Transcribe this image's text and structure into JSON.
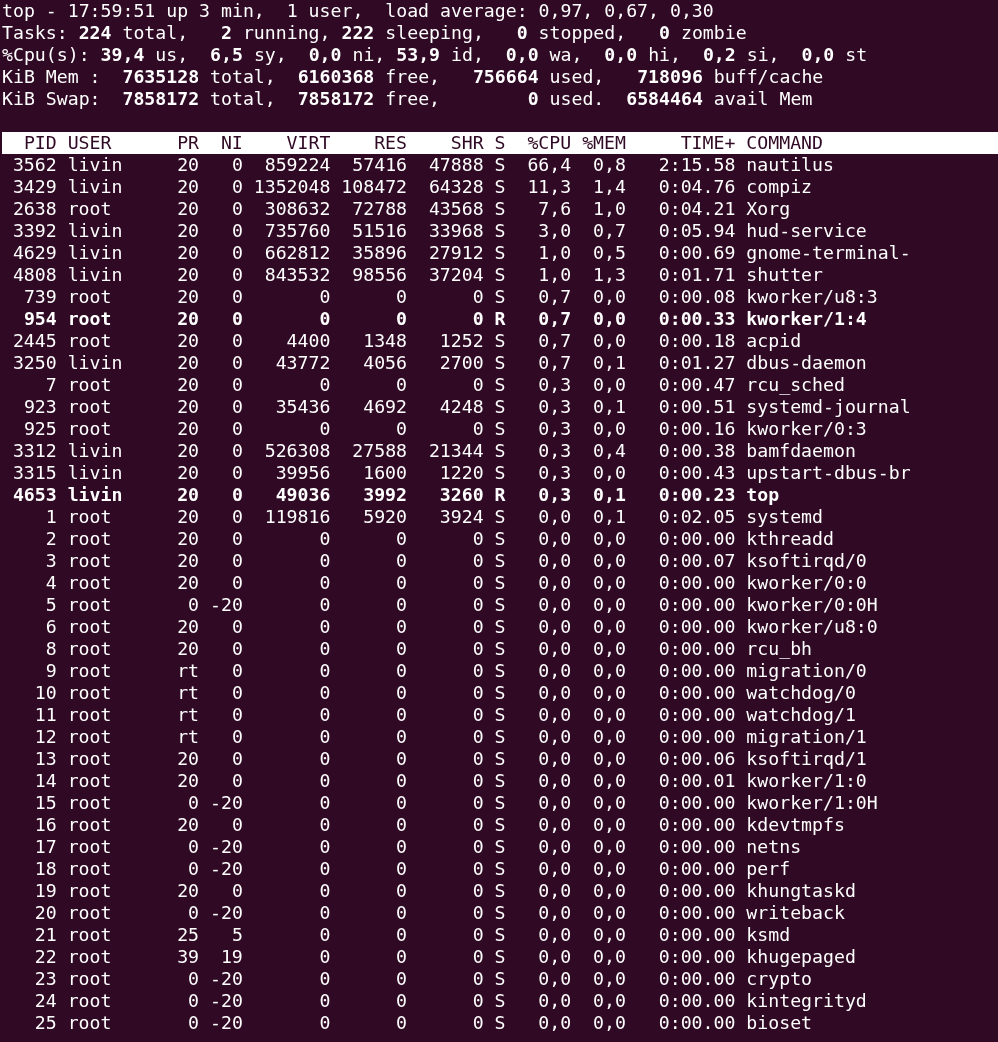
{
  "summary": [
    "top - 17:59:51 up 3 min,  1 user,  load average: 0,97, 0,67, 0,30",
    "Tasks: **224** total,   **2** running, **222** sleeping,   **0** stopped,   **0** zombie",
    "%Cpu(s): **39,4** us,  **6,5** sy,  **0,0** ni, **53,9** id,  **0,0** wa,  **0,0** hi,  **0,2** si,  **0,0** st",
    "KiB Mem :  **7635128** total,  **6160368** free,   **756664** used,   **718096** buff/cache",
    "KiB Swap:  **7858172** total,  **7858172** free,        **0** used.  **6584464** avail Mem"
  ],
  "table": {
    "columns": [
      "PID",
      "USER",
      "PR",
      "NI",
      "VIRT",
      "RES",
      "SHR",
      "S",
      "%CPU",
      "%MEM",
      "TIME+",
      "COMMAND"
    ],
    "rows": [
      {
        "highlighted": false,
        "cells": [
          "3562",
          "livin",
          "20",
          "0",
          "859224",
          "57416",
          "47888",
          "S",
          "66,4",
          "0,8",
          "2:15.58",
          "nautilus"
        ]
      },
      {
        "highlighted": false,
        "cells": [
          "3429",
          "livin",
          "20",
          "0",
          "1352048",
          "108472",
          "64328",
          "S",
          "11,3",
          "1,4",
          "0:04.76",
          "compiz"
        ]
      },
      {
        "highlighted": false,
        "cells": [
          "2638",
          "root",
          "20",
          "0",
          "308632",
          "72788",
          "43568",
          "S",
          "7,6",
          "1,0",
          "0:04.21",
          "Xorg"
        ]
      },
      {
        "highlighted": false,
        "cells": [
          "3392",
          "livin",
          "20",
          "0",
          "735760",
          "51516",
          "33968",
          "S",
          "3,0",
          "0,7",
          "0:05.94",
          "hud-service"
        ]
      },
      {
        "highlighted": false,
        "cells": [
          "4629",
          "livin",
          "20",
          "0",
          "662812",
          "35896",
          "27912",
          "S",
          "1,0",
          "0,5",
          "0:00.69",
          "gnome-terminal-"
        ]
      },
      {
        "highlighted": false,
        "cells": [
          "4808",
          "livin",
          "20",
          "0",
          "843532",
          "98556",
          "37204",
          "S",
          "1,0",
          "1,3",
          "0:01.71",
          "shutter"
        ]
      },
      {
        "highlighted": false,
        "cells": [
          "739",
          "root",
          "20",
          "0",
          "0",
          "0",
          "0",
          "S",
          "0,7",
          "0,0",
          "0:00.08",
          "kworker/u8:3"
        ]
      },
      {
        "highlighted": true,
        "cells": [
          "954",
          "root",
          "20",
          "0",
          "0",
          "0",
          "0",
          "R",
          "0,7",
          "0,0",
          "0:00.33",
          "kworker/1:4"
        ]
      },
      {
        "highlighted": false,
        "cells": [
          "2445",
          "root",
          "20",
          "0",
          "4400",
          "1348",
          "1252",
          "S",
          "0,7",
          "0,0",
          "0:00.18",
          "acpid"
        ]
      },
      {
        "highlighted": false,
        "cells": [
          "3250",
          "livin",
          "20",
          "0",
          "43772",
          "4056",
          "2700",
          "S",
          "0,7",
          "0,1",
          "0:01.27",
          "dbus-daemon"
        ]
      },
      {
        "highlighted": false,
        "cells": [
          "7",
          "root",
          "20",
          "0",
          "0",
          "0",
          "0",
          "S",
          "0,3",
          "0,0",
          "0:00.47",
          "rcu_sched"
        ]
      },
      {
        "highlighted": false,
        "cells": [
          "923",
          "root",
          "20",
          "0",
          "35436",
          "4692",
          "4248",
          "S",
          "0,3",
          "0,1",
          "0:00.51",
          "systemd-journal"
        ]
      },
      {
        "highlighted": false,
        "cells": [
          "925",
          "root",
          "20",
          "0",
          "0",
          "0",
          "0",
          "S",
          "0,3",
          "0,0",
          "0:00.16",
          "kworker/0:3"
        ]
      },
      {
        "highlighted": false,
        "cells": [
          "3312",
          "livin",
          "20",
          "0",
          "526308",
          "27588",
          "21344",
          "S",
          "0,3",
          "0,4",
          "0:00.38",
          "bamfdaemon"
        ]
      },
      {
        "highlighted": false,
        "cells": [
          "3315",
          "livin",
          "20",
          "0",
          "39956",
          "1600",
          "1220",
          "S",
          "0,3",
          "0,0",
          "0:00.43",
          "upstart-dbus-br"
        ]
      },
      {
        "highlighted": true,
        "cells": [
          "4653",
          "livin",
          "20",
          "0",
          "49036",
          "3992",
          "3260",
          "R",
          "0,3",
          "0,1",
          "0:00.23",
          "top"
        ]
      },
      {
        "highlighted": false,
        "cells": [
          "1",
          "root",
          "20",
          "0",
          "119816",
          "5920",
          "3924",
          "S",
          "0,0",
          "0,1",
          "0:02.05",
          "systemd"
        ]
      },
      {
        "highlighted": false,
        "cells": [
          "2",
          "root",
          "20",
          "0",
          "0",
          "0",
          "0",
          "S",
          "0,0",
          "0,0",
          "0:00.00",
          "kthreadd"
        ]
      },
      {
        "highlighted": false,
        "cells": [
          "3",
          "root",
          "20",
          "0",
          "0",
          "0",
          "0",
          "S",
          "0,0",
          "0,0",
          "0:00.07",
          "ksoftirqd/0"
        ]
      },
      {
        "highlighted": false,
        "cells": [
          "4",
          "root",
          "20",
          "0",
          "0",
          "0",
          "0",
          "S",
          "0,0",
          "0,0",
          "0:00.00",
          "kworker/0:0"
        ]
      },
      {
        "highlighted": false,
        "cells": [
          "5",
          "root",
          "0",
          "-20",
          "0",
          "0",
          "0",
          "S",
          "0,0",
          "0,0",
          "0:00.00",
          "kworker/0:0H"
        ]
      },
      {
        "highlighted": false,
        "cells": [
          "6",
          "root",
          "20",
          "0",
          "0",
          "0",
          "0",
          "S",
          "0,0",
          "0,0",
          "0:00.00",
          "kworker/u8:0"
        ]
      },
      {
        "highlighted": false,
        "cells": [
          "8",
          "root",
          "20",
          "0",
          "0",
          "0",
          "0",
          "S",
          "0,0",
          "0,0",
          "0:00.00",
          "rcu_bh"
        ]
      },
      {
        "highlighted": false,
        "cells": [
          "9",
          "root",
          "rt",
          "0",
          "0",
          "0",
          "0",
          "S",
          "0,0",
          "0,0",
          "0:00.00",
          "migration/0"
        ]
      },
      {
        "highlighted": false,
        "cells": [
          "10",
          "root",
          "rt",
          "0",
          "0",
          "0",
          "0",
          "S",
          "0,0",
          "0,0",
          "0:00.00",
          "watchdog/0"
        ]
      },
      {
        "highlighted": false,
        "cells": [
          "11",
          "root",
          "rt",
          "0",
          "0",
          "0",
          "0",
          "S",
          "0,0",
          "0,0",
          "0:00.00",
          "watchdog/1"
        ]
      },
      {
        "highlighted": false,
        "cells": [
          "12",
          "root",
          "rt",
          "0",
          "0",
          "0",
          "0",
          "S",
          "0,0",
          "0,0",
          "0:00.00",
          "migration/1"
        ]
      },
      {
        "highlighted": false,
        "cells": [
          "13",
          "root",
          "20",
          "0",
          "0",
          "0",
          "0",
          "S",
          "0,0",
          "0,0",
          "0:00.06",
          "ksoftirqd/1"
        ]
      },
      {
        "highlighted": false,
        "cells": [
          "14",
          "root",
          "20",
          "0",
          "0",
          "0",
          "0",
          "S",
          "0,0",
          "0,0",
          "0:00.01",
          "kworker/1:0"
        ]
      },
      {
        "highlighted": false,
        "cells": [
          "15",
          "root",
          "0",
          "-20",
          "0",
          "0",
          "0",
          "S",
          "0,0",
          "0,0",
          "0:00.00",
          "kworker/1:0H"
        ]
      },
      {
        "highlighted": false,
        "cells": [
          "16",
          "root",
          "20",
          "0",
          "0",
          "0",
          "0",
          "S",
          "0,0",
          "0,0",
          "0:00.00",
          "kdevtmpfs"
        ]
      },
      {
        "highlighted": false,
        "cells": [
          "17",
          "root",
          "0",
          "-20",
          "0",
          "0",
          "0",
          "S",
          "0,0",
          "0,0",
          "0:00.00",
          "netns"
        ]
      },
      {
        "highlighted": false,
        "cells": [
          "18",
          "root",
          "0",
          "-20",
          "0",
          "0",
          "0",
          "S",
          "0,0",
          "0,0",
          "0:00.00",
          "perf"
        ]
      },
      {
        "highlighted": false,
        "cells": [
          "19",
          "root",
          "20",
          "0",
          "0",
          "0",
          "0",
          "S",
          "0,0",
          "0,0",
          "0:00.00",
          "khungtaskd"
        ]
      },
      {
        "highlighted": false,
        "cells": [
          "20",
          "root",
          "0",
          "-20",
          "0",
          "0",
          "0",
          "S",
          "0,0",
          "0,0",
          "0:00.00",
          "writeback"
        ]
      },
      {
        "highlighted": false,
        "cells": [
          "21",
          "root",
          "25",
          "5",
          "0",
          "0",
          "0",
          "S",
          "0,0",
          "0,0",
          "0:00.00",
          "ksmd"
        ]
      },
      {
        "highlighted": false,
        "cells": [
          "22",
          "root",
          "39",
          "19",
          "0",
          "0",
          "0",
          "S",
          "0,0",
          "0,0",
          "0:00.00",
          "khugepaged"
        ]
      },
      {
        "highlighted": false,
        "cells": [
          "23",
          "root",
          "0",
          "-20",
          "0",
          "0",
          "0",
          "S",
          "0,0",
          "0,0",
          "0:00.00",
          "crypto"
        ]
      },
      {
        "highlighted": false,
        "cells": [
          "24",
          "root",
          "0",
          "-20",
          "0",
          "0",
          "0",
          "S",
          "0,0",
          "0,0",
          "0:00.00",
          "kintegrityd"
        ]
      },
      {
        "highlighted": false,
        "cells": [
          "25",
          "root",
          "0",
          "-20",
          "0",
          "0",
          "0",
          "S",
          "0,0",
          "0,0",
          "0:00.00",
          "bioset"
        ]
      }
    ]
  }
}
